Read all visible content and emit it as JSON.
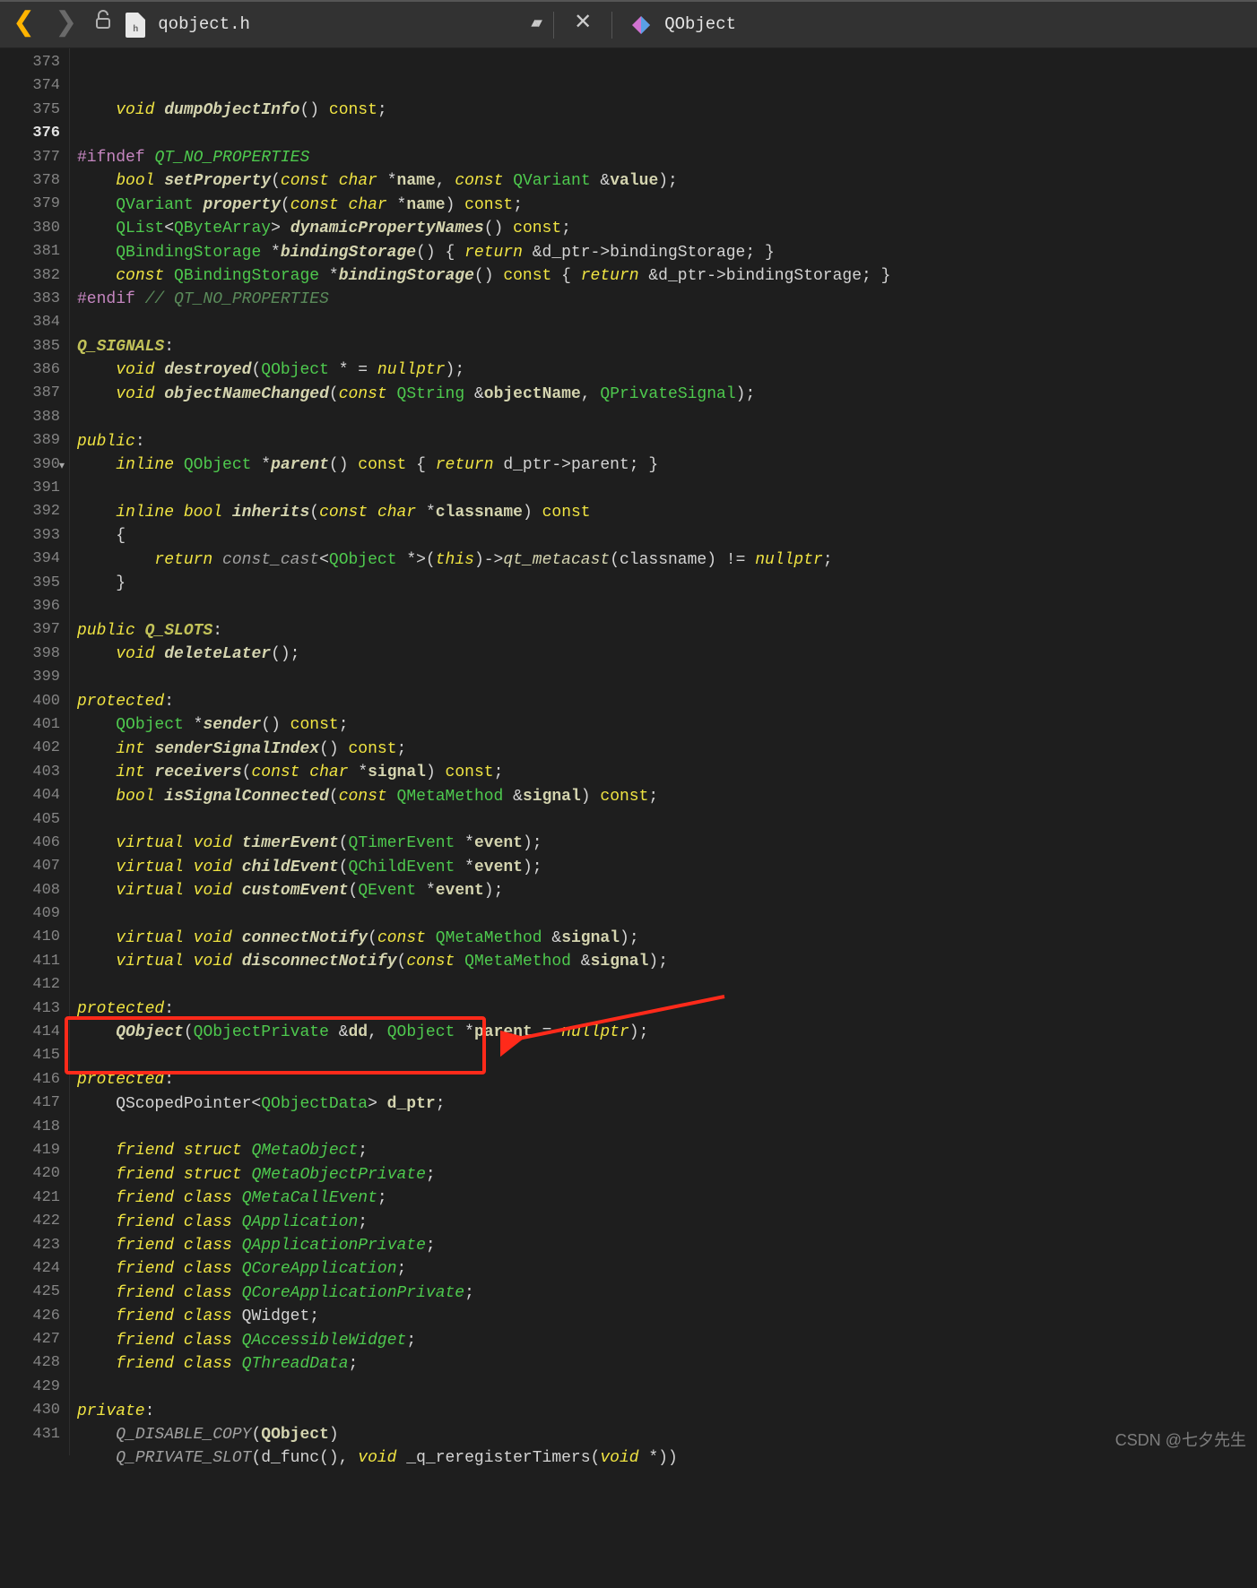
{
  "toolbar": {
    "filename": "qobject.h",
    "class_label": "QObject",
    "file_ext_badge": "h"
  },
  "watermark": "CSDN @七夕先生",
  "gutter": {
    "start": 373,
    "end": 431,
    "current": 376,
    "fold_at": 390
  },
  "highlight": {
    "top_line": 414,
    "bottom_line": 415
  },
  "code": {
    "373": [
      [
        "    ",
        "p"
      ],
      [
        "void",
        "kw"
      ],
      [
        " ",
        "p"
      ],
      [
        "dumpObjectInfo",
        "fn"
      ],
      [
        "() ",
        "p"
      ],
      [
        "const",
        "kw2"
      ],
      [
        ";",
        "p"
      ]
    ],
    "374": [
      [
        "",
        "p"
      ]
    ],
    "375": [
      [
        "#ifndef",
        "macro"
      ],
      [
        " ",
        "p"
      ],
      [
        "QT_NO_PROPERTIES",
        "mval"
      ]
    ],
    "376": [
      [
        "    ",
        "p"
      ],
      [
        "bool",
        "kw"
      ],
      [
        " ",
        "p"
      ],
      [
        "setProperty",
        "fn"
      ],
      [
        "(",
        "p"
      ],
      [
        "const",
        "kw"
      ],
      [
        " ",
        "p"
      ],
      [
        "char",
        "kw"
      ],
      [
        " *",
        "p"
      ],
      [
        "name",
        "id"
      ],
      [
        ", ",
        "p"
      ],
      [
        "const",
        "kw"
      ],
      [
        " ",
        "p"
      ],
      [
        "QVariant",
        "type"
      ],
      [
        " &",
        "p"
      ],
      [
        "value",
        "id"
      ],
      [
        ");",
        "p"
      ]
    ],
    "377": [
      [
        "    ",
        "p"
      ],
      [
        "QVariant",
        "type"
      ],
      [
        " ",
        "p"
      ],
      [
        "property",
        "fn"
      ],
      [
        "(",
        "p"
      ],
      [
        "const",
        "kw"
      ],
      [
        " ",
        "p"
      ],
      [
        "char",
        "kw"
      ],
      [
        " *",
        "p"
      ],
      [
        "name",
        "id"
      ],
      [
        ") ",
        "p"
      ],
      [
        "const",
        "kw2"
      ],
      [
        ";",
        "p"
      ]
    ],
    "378": [
      [
        "    ",
        "p"
      ],
      [
        "QList",
        "type"
      ],
      [
        "<",
        "p"
      ],
      [
        "QByteArray",
        "type"
      ],
      [
        "> ",
        "p"
      ],
      [
        "dynamicPropertyNames",
        "fn"
      ],
      [
        "() ",
        "p"
      ],
      [
        "const",
        "kw2"
      ],
      [
        ";",
        "p"
      ]
    ],
    "379": [
      [
        "    ",
        "p"
      ],
      [
        "QBindingStorage",
        "type"
      ],
      [
        " *",
        "p"
      ],
      [
        "bindingStorage",
        "fn"
      ],
      [
        "() { ",
        "p"
      ],
      [
        "return",
        "kw"
      ],
      [
        " &d_ptr->bindingStorage; }",
        "p"
      ]
    ],
    "380": [
      [
        "    ",
        "p"
      ],
      [
        "const",
        "kw"
      ],
      [
        " ",
        "p"
      ],
      [
        "QBindingStorage",
        "type"
      ],
      [
        " *",
        "p"
      ],
      [
        "bindingStorage",
        "fn"
      ],
      [
        "() ",
        "p"
      ],
      [
        "const",
        "kw2"
      ],
      [
        " { ",
        "p"
      ],
      [
        "return",
        "kw"
      ],
      [
        " &d_ptr->bindingStorage; }",
        "p"
      ]
    ],
    "381": [
      [
        "#endif",
        "macro"
      ],
      [
        " ",
        "p"
      ],
      [
        "// QT_NO_PROPERTIES",
        "cmt"
      ]
    ],
    "382": [
      [
        "",
        "p"
      ]
    ],
    "383": [
      [
        "Q_SIGNALS",
        "sect"
      ],
      [
        ":",
        "p"
      ]
    ],
    "384": [
      [
        "    ",
        "p"
      ],
      [
        "void",
        "kw"
      ],
      [
        " ",
        "p"
      ],
      [
        "destroyed",
        "fn"
      ],
      [
        "(",
        "p"
      ],
      [
        "QObject",
        "type"
      ],
      [
        " * = ",
        "p"
      ],
      [
        "nullptr",
        "kw"
      ],
      [
        ");",
        "p"
      ]
    ],
    "385": [
      [
        "    ",
        "p"
      ],
      [
        "void",
        "kw"
      ],
      [
        " ",
        "p"
      ],
      [
        "objectNameChanged",
        "fn"
      ],
      [
        "(",
        "p"
      ],
      [
        "const",
        "kw"
      ],
      [
        " ",
        "p"
      ],
      [
        "QString",
        "type"
      ],
      [
        " &",
        "p"
      ],
      [
        "objectName",
        "id"
      ],
      [
        ", ",
        "p"
      ],
      [
        "QPrivateSignal",
        "type"
      ],
      [
        ");",
        "p"
      ]
    ],
    "386": [
      [
        "",
        "p"
      ]
    ],
    "387": [
      [
        "public",
        "kw"
      ],
      [
        ":",
        "p"
      ]
    ],
    "388": [
      [
        "    ",
        "p"
      ],
      [
        "inline",
        "kw"
      ],
      [
        " ",
        "p"
      ],
      [
        "QObject",
        "type"
      ],
      [
        " *",
        "p"
      ],
      [
        "parent",
        "fn"
      ],
      [
        "() ",
        "p"
      ],
      [
        "const",
        "kw2"
      ],
      [
        " { ",
        "p"
      ],
      [
        "return",
        "kw"
      ],
      [
        " d_ptr->parent; }",
        "p"
      ]
    ],
    "389": [
      [
        "",
        "p"
      ]
    ],
    "390": [
      [
        "    ",
        "p"
      ],
      [
        "inline",
        "kw"
      ],
      [
        " ",
        "p"
      ],
      [
        "bool",
        "kw"
      ],
      [
        " ",
        "p"
      ],
      [
        "inherits",
        "fn"
      ],
      [
        "(",
        "p"
      ],
      [
        "const",
        "kw"
      ],
      [
        " ",
        "p"
      ],
      [
        "char",
        "kw"
      ],
      [
        " *",
        "p"
      ],
      [
        "classname",
        "id"
      ],
      [
        ") ",
        "p"
      ],
      [
        "const",
        "kw2"
      ]
    ],
    "391": [
      [
        "    {",
        "p"
      ]
    ],
    "392": [
      [
        "        ",
        "p"
      ],
      [
        "return",
        "kw"
      ],
      [
        " ",
        "p"
      ],
      [
        "const_cast",
        "paleit"
      ],
      [
        "<",
        "p"
      ],
      [
        "QObject",
        "type"
      ],
      [
        " *>(",
        "p"
      ],
      [
        "this",
        "kw"
      ],
      [
        ")->",
        "p"
      ],
      [
        "qt_metacast",
        "idit"
      ],
      [
        "(classname) != ",
        "p"
      ],
      [
        "nullptr",
        "kw"
      ],
      [
        ";",
        "p"
      ]
    ],
    "393": [
      [
        "    }",
        "p"
      ]
    ],
    "394": [
      [
        "",
        "p"
      ]
    ],
    "395": [
      [
        "public",
        "kw"
      ],
      [
        " ",
        "p"
      ],
      [
        "Q_SLOTS",
        "sect"
      ],
      [
        ":",
        "p"
      ]
    ],
    "396": [
      [
        "    ",
        "p"
      ],
      [
        "void",
        "kw"
      ],
      [
        " ",
        "p"
      ],
      [
        "deleteLater",
        "fn"
      ],
      [
        "();",
        "p"
      ]
    ],
    "397": [
      [
        "",
        "p"
      ]
    ],
    "398": [
      [
        "protected",
        "kw"
      ],
      [
        ":",
        "p"
      ]
    ],
    "399": [
      [
        "    ",
        "p"
      ],
      [
        "QObject",
        "type"
      ],
      [
        " *",
        "p"
      ],
      [
        "sender",
        "fn"
      ],
      [
        "() ",
        "p"
      ],
      [
        "const",
        "kw2"
      ],
      [
        ";",
        "p"
      ]
    ],
    "400": [
      [
        "    ",
        "p"
      ],
      [
        "int",
        "kw"
      ],
      [
        " ",
        "p"
      ],
      [
        "senderSignalIndex",
        "fn"
      ],
      [
        "() ",
        "p"
      ],
      [
        "const",
        "kw2"
      ],
      [
        ";",
        "p"
      ]
    ],
    "401": [
      [
        "    ",
        "p"
      ],
      [
        "int",
        "kw"
      ],
      [
        " ",
        "p"
      ],
      [
        "receivers",
        "fn"
      ],
      [
        "(",
        "p"
      ],
      [
        "const",
        "kw"
      ],
      [
        " ",
        "p"
      ],
      [
        "char",
        "kw"
      ],
      [
        " *",
        "p"
      ],
      [
        "signal",
        "id"
      ],
      [
        ") ",
        "p"
      ],
      [
        "const",
        "kw2"
      ],
      [
        ";",
        "p"
      ]
    ],
    "402": [
      [
        "    ",
        "p"
      ],
      [
        "bool",
        "kw"
      ],
      [
        " ",
        "p"
      ],
      [
        "isSignalConnected",
        "fn"
      ],
      [
        "(",
        "p"
      ],
      [
        "const",
        "kw"
      ],
      [
        " ",
        "p"
      ],
      [
        "QMetaMethod",
        "type"
      ],
      [
        " &",
        "p"
      ],
      [
        "signal",
        "id"
      ],
      [
        ") ",
        "p"
      ],
      [
        "const",
        "kw2"
      ],
      [
        ";",
        "p"
      ]
    ],
    "403": [
      [
        "",
        "p"
      ]
    ],
    "404": [
      [
        "    ",
        "p"
      ],
      [
        "virtual",
        "kw"
      ],
      [
        " ",
        "p"
      ],
      [
        "void",
        "kw"
      ],
      [
        " ",
        "p"
      ],
      [
        "timerEvent",
        "fn"
      ],
      [
        "(",
        "p"
      ],
      [
        "QTimerEvent",
        "type"
      ],
      [
        " *",
        "p"
      ],
      [
        "event",
        "id"
      ],
      [
        ");",
        "p"
      ]
    ],
    "405": [
      [
        "    ",
        "p"
      ],
      [
        "virtual",
        "kw"
      ],
      [
        " ",
        "p"
      ],
      [
        "void",
        "kw"
      ],
      [
        " ",
        "p"
      ],
      [
        "childEvent",
        "fn"
      ],
      [
        "(",
        "p"
      ],
      [
        "QChildEvent",
        "type"
      ],
      [
        " *",
        "p"
      ],
      [
        "event",
        "id"
      ],
      [
        ");",
        "p"
      ]
    ],
    "406": [
      [
        "    ",
        "p"
      ],
      [
        "virtual",
        "kw"
      ],
      [
        " ",
        "p"
      ],
      [
        "void",
        "kw"
      ],
      [
        " ",
        "p"
      ],
      [
        "customEvent",
        "fn"
      ],
      [
        "(",
        "p"
      ],
      [
        "QEvent",
        "type"
      ],
      [
        " *",
        "p"
      ],
      [
        "event",
        "id"
      ],
      [
        ");",
        "p"
      ]
    ],
    "407": [
      [
        "",
        "p"
      ]
    ],
    "408": [
      [
        "    ",
        "p"
      ],
      [
        "virtual",
        "kw"
      ],
      [
        " ",
        "p"
      ],
      [
        "void",
        "kw"
      ],
      [
        " ",
        "p"
      ],
      [
        "connectNotify",
        "fn"
      ],
      [
        "(",
        "p"
      ],
      [
        "const",
        "kw"
      ],
      [
        " ",
        "p"
      ],
      [
        "QMetaMethod",
        "type"
      ],
      [
        " &",
        "p"
      ],
      [
        "signal",
        "id"
      ],
      [
        ");",
        "p"
      ]
    ],
    "409": [
      [
        "    ",
        "p"
      ],
      [
        "virtual",
        "kw"
      ],
      [
        " ",
        "p"
      ],
      [
        "void",
        "kw"
      ],
      [
        " ",
        "p"
      ],
      [
        "disconnectNotify",
        "fn"
      ],
      [
        "(",
        "p"
      ],
      [
        "const",
        "kw"
      ],
      [
        " ",
        "p"
      ],
      [
        "QMetaMethod",
        "type"
      ],
      [
        " &",
        "p"
      ],
      [
        "signal",
        "id"
      ],
      [
        ");",
        "p"
      ]
    ],
    "410": [
      [
        "",
        "p"
      ]
    ],
    "411": [
      [
        "protected",
        "kw"
      ],
      [
        ":",
        "p"
      ]
    ],
    "412": [
      [
        "    ",
        "p"
      ],
      [
        "QObject",
        "fn"
      ],
      [
        "(",
        "p"
      ],
      [
        "QObjectPrivate",
        "type"
      ],
      [
        " &",
        "p"
      ],
      [
        "dd",
        "id"
      ],
      [
        ", ",
        "p"
      ],
      [
        "QObject",
        "type"
      ],
      [
        " *",
        "p"
      ],
      [
        "parent",
        "id"
      ],
      [
        " = ",
        "p"
      ],
      [
        "nullptr",
        "kw"
      ],
      [
        ");",
        "p"
      ]
    ],
    "413": [
      [
        "",
        "p"
      ]
    ],
    "414": [
      [
        "protected",
        "kw"
      ],
      [
        ":",
        "p"
      ]
    ],
    "415": [
      [
        "    QScopedPointer<",
        "p"
      ],
      [
        "QObjectData",
        "type"
      ],
      [
        "> ",
        "p"
      ],
      [
        "d_ptr",
        "id"
      ],
      [
        ";",
        "p"
      ]
    ],
    "416": [
      [
        "",
        "p"
      ]
    ],
    "417": [
      [
        "    ",
        "p"
      ],
      [
        "friend",
        "kw"
      ],
      [
        " ",
        "p"
      ],
      [
        "struct",
        "kw"
      ],
      [
        " ",
        "p"
      ],
      [
        "QMetaObject",
        "typeit"
      ],
      [
        ";",
        "p"
      ]
    ],
    "418": [
      [
        "    ",
        "p"
      ],
      [
        "friend",
        "kw"
      ],
      [
        " ",
        "p"
      ],
      [
        "struct",
        "kw"
      ],
      [
        " ",
        "p"
      ],
      [
        "QMetaObjectPrivate",
        "typeit"
      ],
      [
        ";",
        "p"
      ]
    ],
    "419": [
      [
        "    ",
        "p"
      ],
      [
        "friend",
        "kw"
      ],
      [
        " ",
        "p"
      ],
      [
        "class",
        "kw"
      ],
      [
        " ",
        "p"
      ],
      [
        "QMetaCallEvent",
        "typeit"
      ],
      [
        ";",
        "p"
      ]
    ],
    "420": [
      [
        "    ",
        "p"
      ],
      [
        "friend",
        "kw"
      ],
      [
        " ",
        "p"
      ],
      [
        "class",
        "kw"
      ],
      [
        " ",
        "p"
      ],
      [
        "QApplication",
        "typeit"
      ],
      [
        ";",
        "p"
      ]
    ],
    "421": [
      [
        "    ",
        "p"
      ],
      [
        "friend",
        "kw"
      ],
      [
        " ",
        "p"
      ],
      [
        "class",
        "kw"
      ],
      [
        " ",
        "p"
      ],
      [
        "QApplicationPrivate",
        "typeit"
      ],
      [
        ";",
        "p"
      ]
    ],
    "422": [
      [
        "    ",
        "p"
      ],
      [
        "friend",
        "kw"
      ],
      [
        " ",
        "p"
      ],
      [
        "class",
        "kw"
      ],
      [
        " ",
        "p"
      ],
      [
        "QCoreApplication",
        "typeit"
      ],
      [
        ";",
        "p"
      ]
    ],
    "423": [
      [
        "    ",
        "p"
      ],
      [
        "friend",
        "kw"
      ],
      [
        " ",
        "p"
      ],
      [
        "class",
        "kw"
      ],
      [
        " ",
        "p"
      ],
      [
        "QCoreApplicationPrivate",
        "typeit"
      ],
      [
        ";",
        "p"
      ]
    ],
    "424": [
      [
        "    ",
        "p"
      ],
      [
        "friend",
        "kw"
      ],
      [
        " ",
        "p"
      ],
      [
        "class",
        "kw"
      ],
      [
        " QWidget;",
        "p"
      ]
    ],
    "425": [
      [
        "    ",
        "p"
      ],
      [
        "friend",
        "kw"
      ],
      [
        " ",
        "p"
      ],
      [
        "class",
        "kw"
      ],
      [
        " ",
        "p"
      ],
      [
        "QAccessibleWidget",
        "typeit"
      ],
      [
        ";",
        "p"
      ]
    ],
    "426": [
      [
        "    ",
        "p"
      ],
      [
        "friend",
        "kw"
      ],
      [
        " ",
        "p"
      ],
      [
        "class",
        "kw"
      ],
      [
        " ",
        "p"
      ],
      [
        "QThreadData",
        "typeit"
      ],
      [
        ";",
        "p"
      ]
    ],
    "427": [
      [
        "",
        "p"
      ]
    ],
    "428": [
      [
        "private",
        "kw"
      ],
      [
        ":",
        "p"
      ]
    ],
    "429": [
      [
        "    ",
        "p"
      ],
      [
        "Q_DISABLE_COPY",
        "paleit"
      ],
      [
        "(",
        "p"
      ],
      [
        "QObject",
        "id"
      ],
      [
        ")",
        "p"
      ]
    ],
    "430": [
      [
        "    ",
        "p"
      ],
      [
        "Q_PRIVATE_SLOT",
        "paleit"
      ],
      [
        "(d_func(), ",
        "p"
      ],
      [
        "void",
        "kw"
      ],
      [
        " _q_reregisterTimers(",
        "p"
      ],
      [
        "void",
        "kw"
      ],
      [
        " *))",
        "p"
      ]
    ],
    "431": [
      [
        "",
        "p"
      ]
    ]
  }
}
